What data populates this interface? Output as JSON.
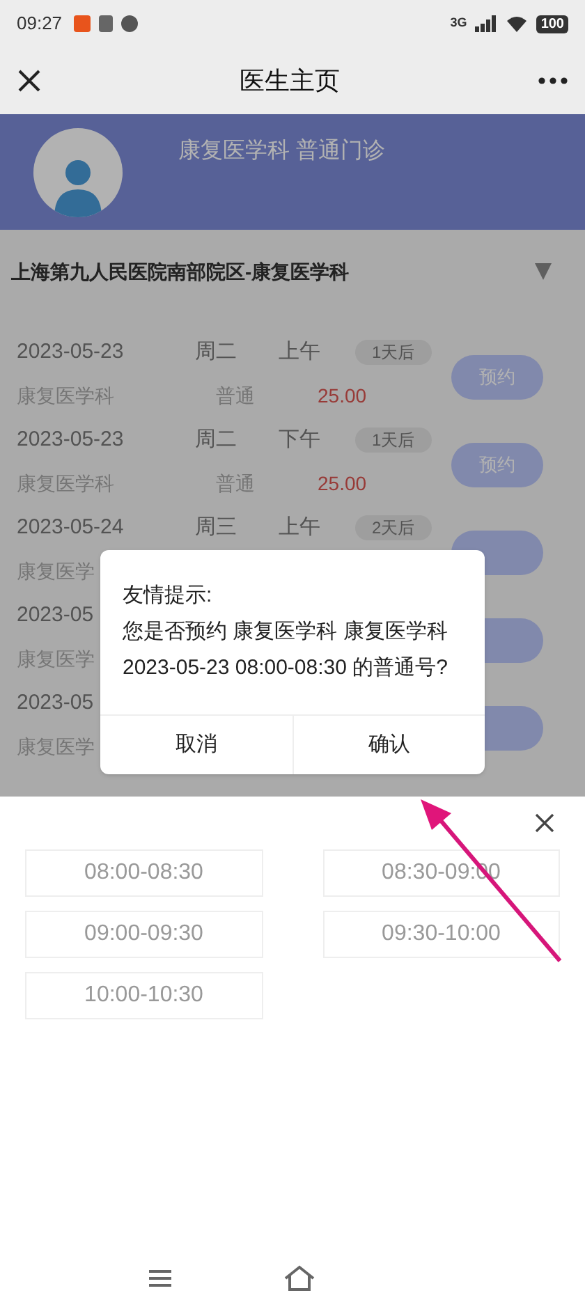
{
  "status_bar": {
    "time": "09:27",
    "network": "3G",
    "battery": "100"
  },
  "nav": {
    "title": "医生主页"
  },
  "doctor": {
    "title": "康复医学科 普通门诊"
  },
  "hospital": {
    "name": "上海第九人民医院南部院区-康复医学科"
  },
  "schedule": [
    {
      "date": "2023-05-23",
      "weekday": "周二",
      "period": "上午",
      "days": "1天后",
      "dept": "康复医学科",
      "type": "普通",
      "price": "25.00",
      "action": "预约"
    },
    {
      "date": "2023-05-23",
      "weekday": "周二",
      "period": "下午",
      "days": "1天后",
      "dept": "康复医学科",
      "type": "普通",
      "price": "25.00",
      "action": "预约"
    },
    {
      "date": "2023-05-24",
      "weekday": "周三",
      "period": "上午",
      "days": "2天后",
      "dept": "康复医学"
    },
    {
      "date": "2023-05",
      "dept": "康复医学"
    },
    {
      "date": "2023-05",
      "dept": "康复医学"
    }
  ],
  "dialog": {
    "title": "友情提示:",
    "message": "您是否预约 康复医学科 康复医学科 2023-05-23 08:00-08:30 的普通号?",
    "buttons": [
      "取消",
      "确认"
    ]
  },
  "time_slots": [
    "08:00-08:30",
    "08:30-09:00",
    "09:00-09:30",
    "09:30-10:00",
    "10:00-10:30"
  ]
}
